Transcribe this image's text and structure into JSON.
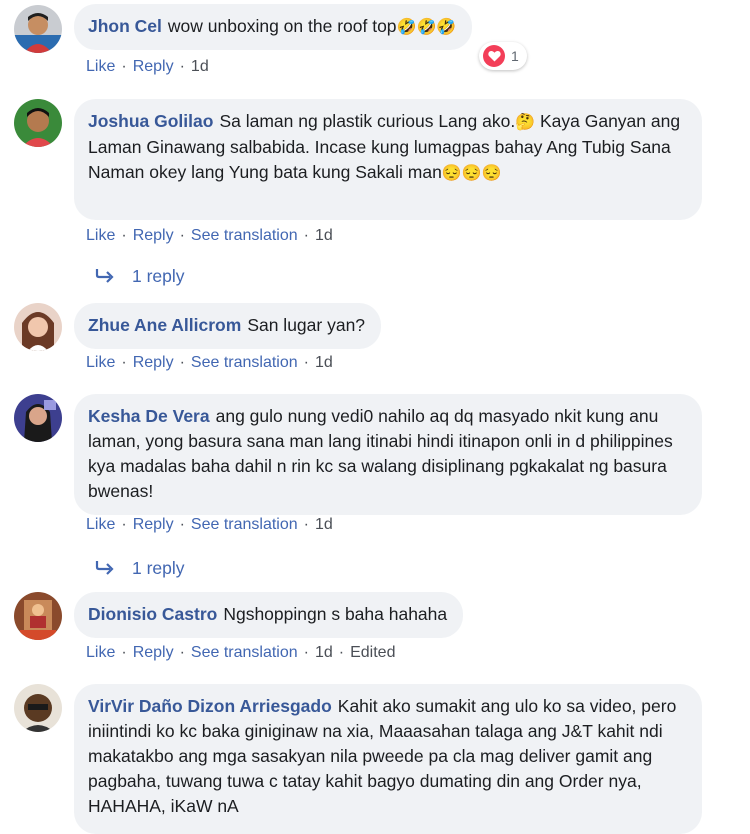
{
  "actions": {
    "like": "Like",
    "reply": "Reply",
    "see_translation": "See translation",
    "edited": "Edited",
    "separator": "·"
  },
  "comments": [
    {
      "author": "Jhon Cel",
      "text": "wow unboxing on the roof top",
      "emoji": "🤣🤣🤣",
      "time": "1d",
      "reaction_count": "1"
    },
    {
      "author": "Joshua Golilao",
      "text": "Sa laman ng plastik curious Lang ako.",
      "emoji1": "🤔",
      "text2": " Kaya Ganyan ang Laman Ginawang salbabida. Incase kung lumagpas bahay Ang Tubig Sana Naman okey lang Yung bata kung Sakali man",
      "emoji2": "😔😔😔",
      "time": "1d",
      "replies": "1 reply"
    },
    {
      "author": "Zhue Ane Allicrom",
      "text": "San lugar yan?",
      "time": "1d"
    },
    {
      "author": "Kesha De Vera",
      "text": "ang gulo nung vedi0 nahilo aq dq masyado nkit kung anu laman, yong basura sana man lang itinabi hindi itinapon onli in d philippines kya madalas baha dahil n rin kc sa walang disiplinang pgkakalat ng basura bwenas!",
      "time": "1d",
      "replies": "1 reply"
    },
    {
      "author": "Dionisio Castro",
      "text": "Ngshoppingn s baha hahaha",
      "time": "1d"
    },
    {
      "author": "VirVir Daño Dizon Arriesgado",
      "text": "Kahit ako sumakit ang ulo ko sa video, pero iniintindi ko kc baka giniginaw na xia, Maaasahan talaga ang J&T kahit ndi makatakbo ang mga sasakyan nila pweede pa cla mag deliver gamit ang pagbaha, tuwang tuwa c tatay kahit bagyo dumating din ang Order nya, HAHAHA, iKaW nA"
    }
  ]
}
